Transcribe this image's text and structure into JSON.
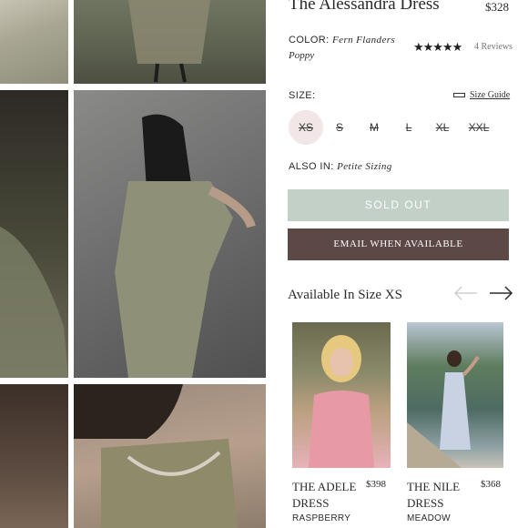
{
  "product": {
    "title": "The Alessandra Dress",
    "price": "$328",
    "color_label": "COLOR:",
    "color_value_line1": "Fern Flanders",
    "color_value_line2": "Poppy",
    "rating": 4.5,
    "stars_glyph": "★★★★★",
    "reviews_text": "4 Reviews"
  },
  "size": {
    "label": "SIZE:",
    "guide_label": "Size Guide",
    "options": [
      "XS",
      "S",
      "M",
      "L",
      "XL",
      "XXL"
    ],
    "selected": "XS"
  },
  "also_in": {
    "label": "ALSO IN:",
    "value": "Petite Sizing"
  },
  "buttons": {
    "sold_out": "SOLD OUT",
    "email": "EMAIL WHEN AVAILABLE"
  },
  "available": {
    "title": "Available In Size XS",
    "cards": [
      {
        "name": "THE ADELE DRESS",
        "price": "$398",
        "color": "RASPBERRY"
      },
      {
        "name": "THE NILE DRESS",
        "price": "$368",
        "color": "MEADOW"
      }
    ]
  },
  "colors": {
    "sold_out_bg": "#c3d0c8",
    "email_bg": "#5c4844",
    "selected_size_bg": "#f2e6e6"
  },
  "icons": {
    "prev": "arrow-left-icon",
    "next": "arrow-right-icon",
    "ruler": "ruler-icon",
    "star": "star-icon"
  }
}
